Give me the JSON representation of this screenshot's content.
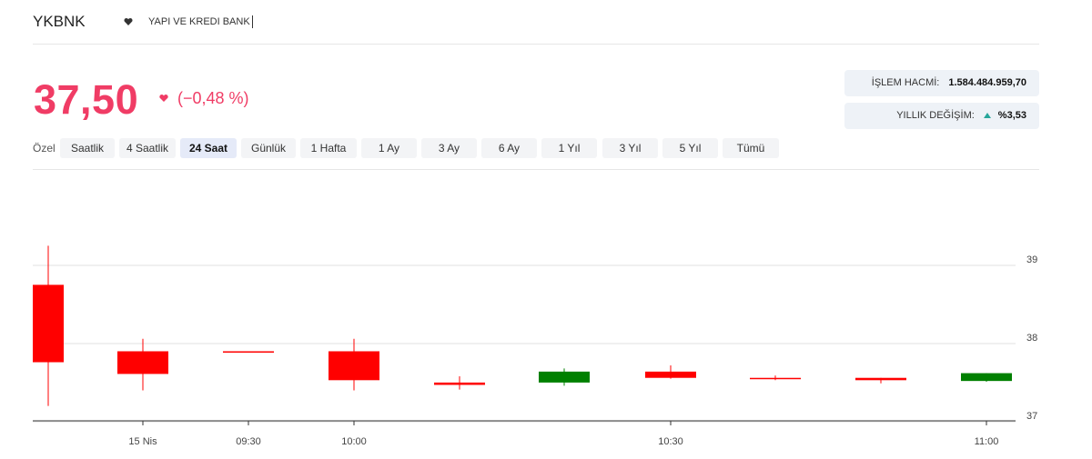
{
  "header": {
    "ticker": "YKBNK",
    "company": "YAPI VE KREDI BANK"
  },
  "quote": {
    "price": "37,50",
    "change": "(−0,48 %)",
    "direction": "down"
  },
  "stats": {
    "volume_label": "İŞLEM HACMİ:",
    "volume_value": "1.584.484.959,70",
    "yearly_label": "YILLIK DEĞİŞİM:",
    "yearly_value": "%3,53",
    "yearly_direction": "up"
  },
  "ranges": {
    "label": "Özel",
    "items": [
      "Saatlik",
      "4 Saatlik",
      "24 Saat",
      "Günlük",
      "1 Hafta",
      "1 Ay",
      "3 Ay",
      "6 Ay",
      "1 Yıl",
      "3 Yıl",
      "5 Yıl",
      "Tümü"
    ],
    "active": "24 Saat"
  },
  "colors": {
    "accent": "#f03c65",
    "candle_down": "#ff0000",
    "candle_up": "#008000",
    "up_arrow": "#26a69a"
  },
  "chart_data": {
    "type": "candlestick",
    "x_ticks": [
      "15 Nis",
      "09:30",
      "10:00",
      "10:30",
      "11:00"
    ],
    "y_ticks": [
      37,
      38,
      39
    ],
    "ylim": [
      37,
      39.2
    ],
    "grid": true,
    "candles": [
      {
        "open": 38.67,
        "high": 39.17,
        "low": 37.12,
        "close": 37.68
      },
      {
        "open": 37.82,
        "high": 37.98,
        "low": 37.32,
        "close": 37.53
      },
      {
        "open": 37.82,
        "high": 37.82,
        "low": 37.82,
        "close": 37.82
      },
      {
        "open": 37.82,
        "high": 37.98,
        "low": 37.32,
        "close": 37.45
      },
      {
        "open": 37.42,
        "high": 37.5,
        "low": 37.33,
        "close": 37.39
      },
      {
        "open": 37.42,
        "high": 37.6,
        "low": 37.38,
        "close": 37.56
      },
      {
        "open": 37.56,
        "high": 37.64,
        "low": 37.47,
        "close": 37.48
      },
      {
        "open": 37.48,
        "high": 37.51,
        "low": 37.45,
        "close": 37.47
      },
      {
        "open": 37.48,
        "high": 37.48,
        "low": 37.41,
        "close": 37.45
      },
      {
        "open": 37.44,
        "high": 37.54,
        "low": 37.43,
        "close": 37.54
      }
    ]
  }
}
